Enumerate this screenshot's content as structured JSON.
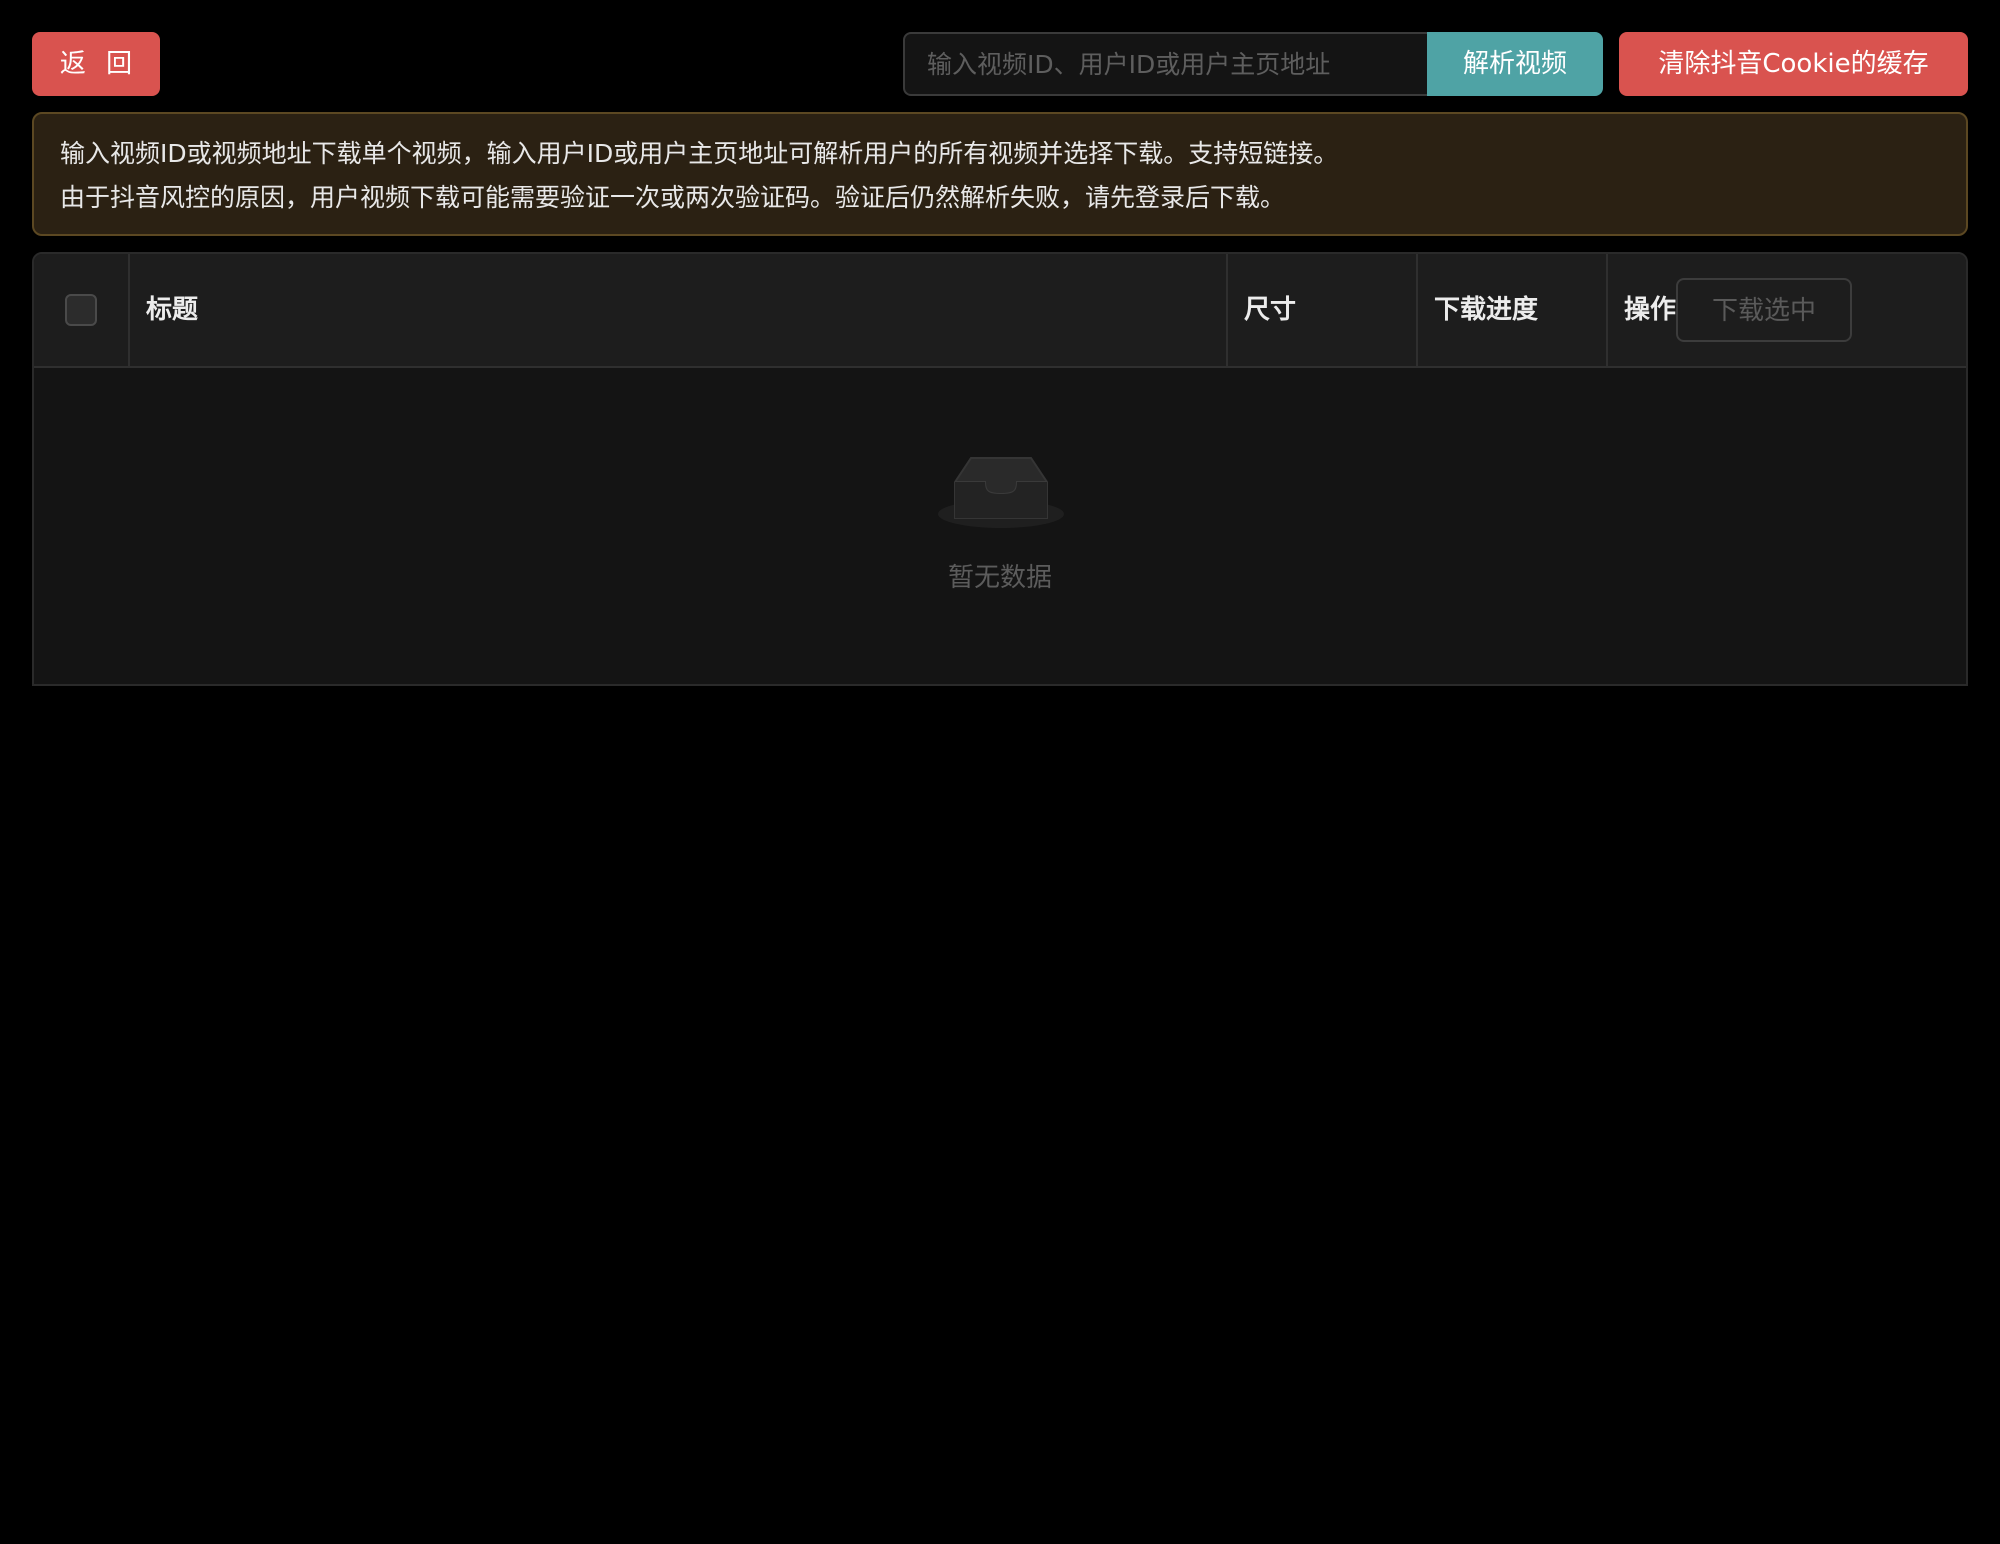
{
  "toolbar": {
    "back_label": "返 回",
    "search_placeholder": "输入视频ID、用户ID或用户主页地址",
    "search_value": "",
    "parse_label": "解析视频",
    "clear_label": "清除抖音Cookie的缓存"
  },
  "notice": {
    "line1": "输入视频ID或视频地址下载单个视频，输入用户ID或用户主页地址可解析用户的所有视频并选择下载。支持短链接。",
    "line2": "由于抖音风控的原因，用户视频下载可能需要验证一次或两次验证码。验证后仍然解析失败，请先登录后下载。"
  },
  "table": {
    "columns": {
      "title": "标题",
      "size": "尺寸",
      "progress": "下载进度",
      "action": "操作"
    },
    "download_selected_label": "下载选中",
    "select_all_checked": false,
    "rows": [],
    "empty_text": "暂无数据"
  },
  "colors": {
    "danger": "#d9534f",
    "primary": "#4fa3a5",
    "notice_bg": "#2b2113",
    "background": "#000000"
  },
  "icons": {
    "empty": "empty-inbox-icon"
  }
}
